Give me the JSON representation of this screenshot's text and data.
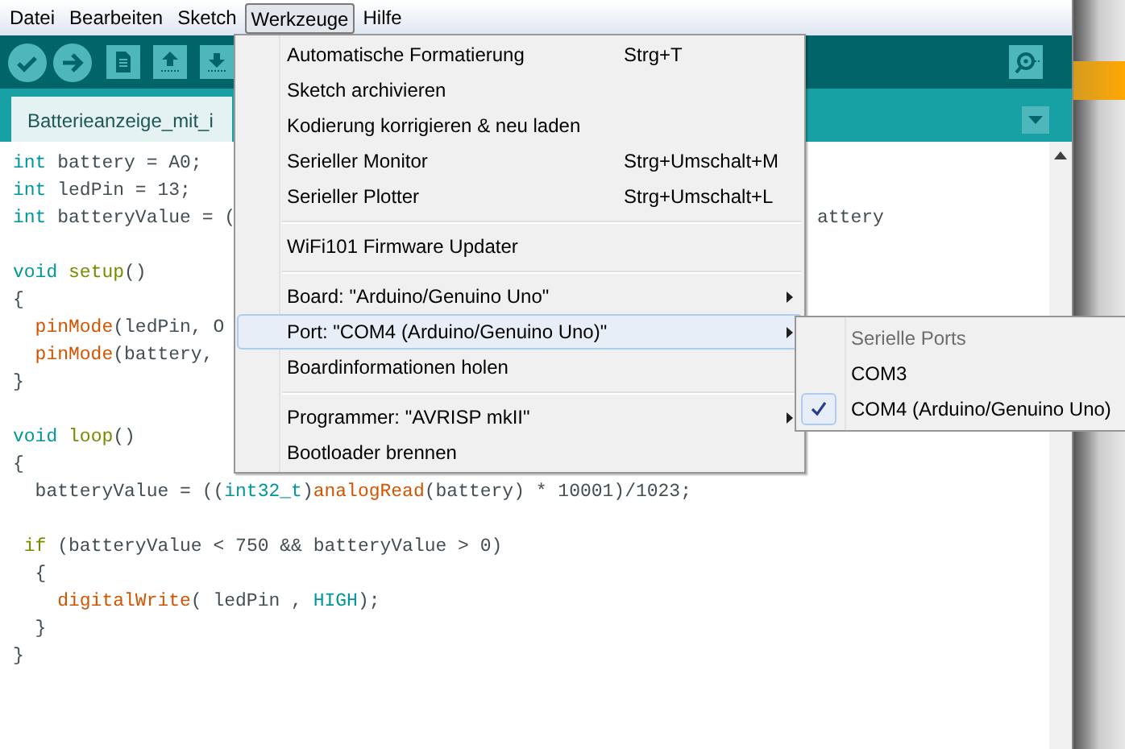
{
  "menu_bar": [
    {
      "label": "Datei",
      "selected": false
    },
    {
      "label": "Bearbeiten",
      "selected": false
    },
    {
      "label": "Sketch",
      "selected": false
    },
    {
      "label": "Werkzeuge",
      "selected": true
    },
    {
      "label": "Hilfe",
      "selected": false
    }
  ],
  "tab": {
    "title": "Batterieanzeige_mit_i"
  },
  "editor": {
    "lines": [
      {
        "segments": [
          {
            "text": "int",
            "kind": "keyword"
          },
          {
            "text": " battery = A0;",
            "kind": "plain"
          }
        ]
      },
      {
        "segments": [
          {
            "text": "int",
            "kind": "keyword"
          },
          {
            "text": " ledPin = 13;",
            "kind": "plain"
          }
        ]
      },
      {
        "segments": [
          {
            "text": "int",
            "kind": "keyword"
          },
          {
            "text": " batteryValue = (",
            "kind": "plain"
          }
        ],
        "tail": "attery"
      },
      {
        "kind": "blank"
      },
      {
        "segments": [
          {
            "text": "void",
            "kind": "keyword"
          },
          {
            "text": " setup",
            "kind": "structure"
          },
          {
            "text": "()",
            "kind": "plain"
          }
        ]
      },
      {
        "segments": [
          {
            "text": "{",
            "kind": "plain"
          }
        ]
      },
      {
        "segments": [
          {
            "text": "  pinMode",
            "kind": "function"
          },
          {
            "text": "(ledPin, O",
            "kind": "plain"
          }
        ]
      },
      {
        "segments": [
          {
            "text": "  pinMode",
            "kind": "function"
          },
          {
            "text": "(battery,",
            "kind": "plain"
          }
        ]
      },
      {
        "segments": [
          {
            "text": "}",
            "kind": "plain"
          }
        ]
      },
      {
        "kind": "blank"
      },
      {
        "segments": [
          {
            "text": "void",
            "kind": "keyword"
          },
          {
            "text": " loop",
            "kind": "structure"
          },
          {
            "text": "()",
            "kind": "plain"
          }
        ]
      },
      {
        "segments": [
          {
            "text": "{",
            "kind": "plain"
          }
        ]
      },
      {
        "segments": [
          {
            "text": "  batteryValue = ((",
            "kind": "plain"
          },
          {
            "text": "int32_t",
            "kind": "keyword"
          },
          {
            "text": ")",
            "kind": "plain"
          },
          {
            "text": "analogRead",
            "kind": "function"
          },
          {
            "text": "(battery) * 10001)/1023;",
            "kind": "plain"
          }
        ]
      },
      {
        "kind": "blank"
      },
      {
        "segments": [
          {
            "text": " if",
            "kind": "structure"
          },
          {
            "text": " (batteryValue < 750 && batteryValue > 0)",
            "kind": "plain"
          }
        ]
      },
      {
        "segments": [
          {
            "text": "  {",
            "kind": "plain"
          }
        ]
      },
      {
        "segments": [
          {
            "text": "    digitalWrite",
            "kind": "function"
          },
          {
            "text": "( ledPin , ",
            "kind": "plain"
          },
          {
            "text": "HIGH",
            "kind": "keyword"
          },
          {
            "text": ");",
            "kind": "plain"
          }
        ]
      },
      {
        "segments": [
          {
            "text": "  }",
            "kind": "plain"
          }
        ]
      },
      {
        "segments": [
          {
            "text": "}",
            "kind": "plain"
          }
        ]
      }
    ]
  },
  "tools_menu": {
    "items": [
      {
        "kind": "item",
        "label": "Automatische Formatierung",
        "shortcut": "Strg+T",
        "submenu": false,
        "selected": false
      },
      {
        "kind": "item",
        "label": "Sketch archivieren",
        "submenu": false,
        "selected": false
      },
      {
        "kind": "item",
        "label": "Kodierung korrigieren & neu laden",
        "submenu": false,
        "selected": false
      },
      {
        "kind": "item",
        "label": "Serieller Monitor",
        "shortcut": "Strg+Umschalt+M",
        "submenu": false,
        "selected": false
      },
      {
        "kind": "item",
        "label": "Serieller Plotter",
        "shortcut": "Strg+Umschalt+L",
        "submenu": false,
        "selected": false
      },
      {
        "kind": "separator"
      },
      {
        "kind": "item",
        "label": "WiFi101 Firmware Updater",
        "submenu": false,
        "selected": false
      },
      {
        "kind": "separator"
      },
      {
        "kind": "item",
        "label": "Board: \"Arduino/Genuino Uno\"",
        "submenu": true,
        "selected": false
      },
      {
        "kind": "item",
        "label": "Port: \"COM4 (Arduino/Genuino Uno)\"",
        "submenu": true,
        "selected": true
      },
      {
        "kind": "item",
        "label": "Boardinformationen holen",
        "submenu": false,
        "selected": false
      },
      {
        "kind": "separator"
      },
      {
        "kind": "item",
        "label": "Programmer: \"AVRISP mkII\"",
        "submenu": true,
        "selected": false
      },
      {
        "kind": "item",
        "label": "Bootloader brennen",
        "submenu": false,
        "selected": false
      }
    ]
  },
  "port_submenu": {
    "items": [
      {
        "kind": "header",
        "label": "Serielle Ports"
      },
      {
        "kind": "option",
        "label": "COM3",
        "checked": false
      },
      {
        "kind": "option",
        "label": "COM4 (Arduino/Genuino Uno)",
        "checked": true
      }
    ]
  }
}
